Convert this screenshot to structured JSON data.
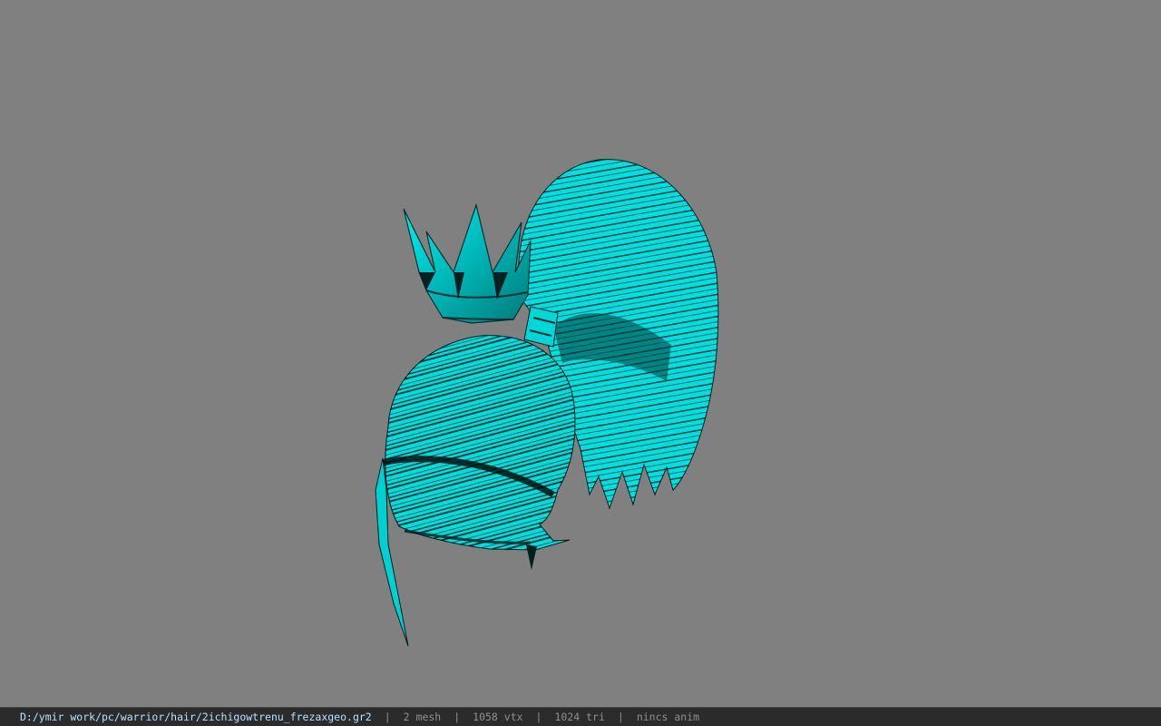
{
  "viewer": {
    "background_color": "#808080",
    "model_color": "#00e5e5",
    "model_shadow_color": "#002b2b",
    "model_description_icon": "hair-mesh-model-with-crown"
  },
  "status_bar": {
    "file_path": "D:/ymir work/pc/warrior/hair/2ichigowtrenu_frezaxgeo.gr2",
    "separator": "|",
    "mesh_count": "2 mesh",
    "vertex_count": "1058 vtx",
    "triangle_count": "1024 tri",
    "anim_status": "nincs anim"
  }
}
